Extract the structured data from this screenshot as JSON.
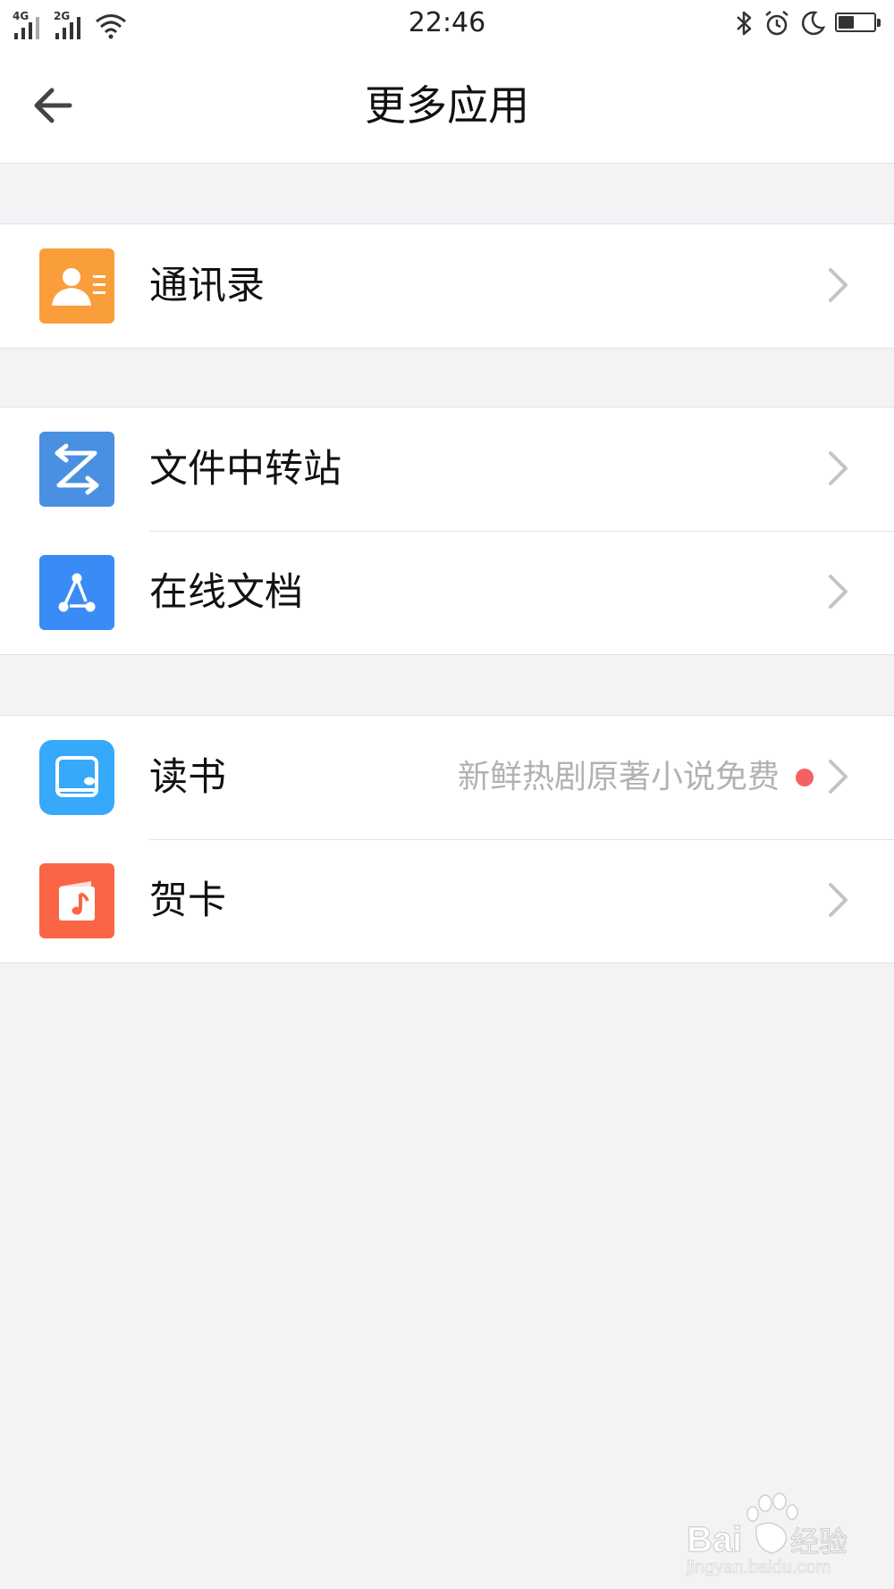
{
  "status_bar": {
    "signal_1_label": "4G",
    "signal_2_label": "2G",
    "time": "22:46",
    "battery_level": 0.45
  },
  "header": {
    "title": "更多应用"
  },
  "rows": [
    {
      "label": "通讯录",
      "icon": "contacts-icon",
      "icon_color": "#fa9d3b"
    },
    {
      "label": "文件中转站",
      "icon": "file-transfer-icon",
      "icon_color": "#4a90e2"
    },
    {
      "label": "在线文档",
      "icon": "online-doc-icon",
      "icon_color": "#3a8bf6"
    },
    {
      "label": "读书",
      "icon": "reading-icon",
      "icon_color": "#36a9fb",
      "subtitle": "新鲜热剧原著小说免费",
      "badge_color": "#f56161"
    },
    {
      "label": "贺卡",
      "icon": "greeting-card-icon",
      "icon_color": "#fa6545"
    }
  ],
  "watermark": {
    "brand": "Bai",
    "brand_suffix": "经验",
    "url": "jingyan.baidu.com"
  }
}
